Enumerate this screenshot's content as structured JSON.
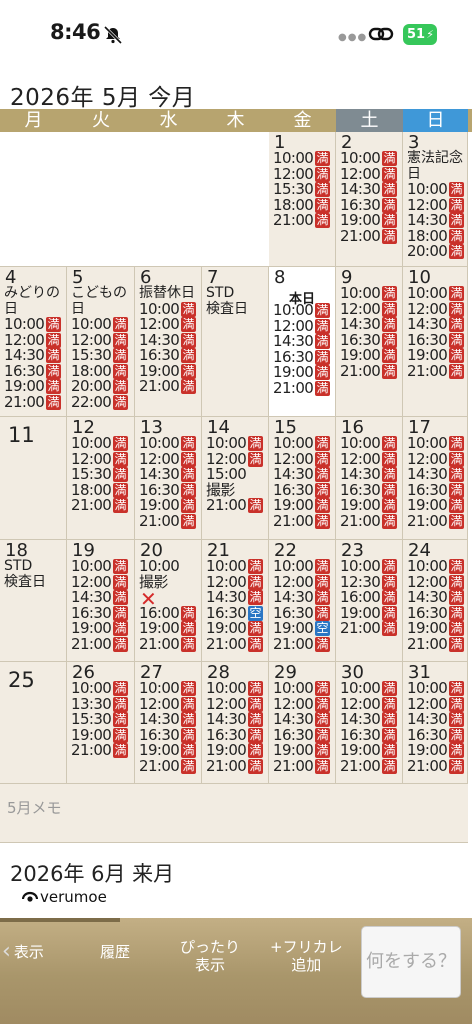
{
  "status_bar": {
    "time": "8:46",
    "battery": "51"
  },
  "current_month": {
    "title": "2026年 5月 今月"
  },
  "weekdays": [
    "月",
    "火",
    "水",
    "木",
    "金",
    "土",
    "日"
  ],
  "days": [
    {
      "n": "1",
      "slots": [
        [
          "10:00",
          "満"
        ],
        [
          "12:00",
          "満"
        ],
        [
          "15:30",
          "満"
        ],
        [
          "18:00",
          "満"
        ],
        [
          "21:00",
          "満"
        ]
      ]
    },
    {
      "n": "2",
      "slots": [
        [
          "10:00",
          "満"
        ],
        [
          "12:00",
          "満"
        ],
        [
          "14:30",
          "満"
        ],
        [
          "16:30",
          "満"
        ],
        [
          "19:00",
          "満"
        ],
        [
          "21:00",
          "満"
        ]
      ]
    },
    {
      "n": "3",
      "note": "憲法記念\n日",
      "slots": [
        [
          "10:00",
          "満"
        ],
        [
          "12:00",
          "満"
        ],
        [
          "14:30",
          "満"
        ],
        [
          "18:00",
          "満"
        ],
        [
          "20:00",
          "満"
        ]
      ]
    },
    {
      "n": "4",
      "note": "みどりの\n日",
      "slots": [
        [
          "10:00",
          "満"
        ],
        [
          "12:00",
          "満"
        ],
        [
          "14:30",
          "満"
        ],
        [
          "16:30",
          "満"
        ],
        [
          "19:00",
          "満"
        ],
        [
          "21:00",
          "満"
        ]
      ]
    },
    {
      "n": "5",
      "note": "こどもの\n日",
      "slots": [
        [
          "10:00",
          "満"
        ],
        [
          "12:00",
          "満"
        ],
        [
          "15:30",
          "満"
        ],
        [
          "18:00",
          "満"
        ],
        [
          "20:00",
          "満"
        ],
        [
          "22:00",
          "満"
        ]
      ]
    },
    {
      "n": "6",
      "note": "振替休日",
      "slots": [
        [
          "10:00",
          "満"
        ],
        [
          "12:00",
          "満"
        ],
        [
          "14:30",
          "満"
        ],
        [
          "16:30",
          "満"
        ],
        [
          "19:00",
          "満"
        ],
        [
          "21:00",
          "満"
        ]
      ]
    },
    {
      "n": "7",
      "note": "STD\n検査日",
      "slots": []
    },
    {
      "n": "8",
      "today": "本日",
      "slots": [
        [
          "10:00",
          "満"
        ],
        [
          "12:00",
          "満"
        ],
        [
          "14:30",
          "満"
        ],
        [
          "16:30",
          "満"
        ],
        [
          "19:00",
          "満"
        ],
        [
          "21:00",
          "満"
        ]
      ]
    },
    {
      "n": "9",
      "slots": [
        [
          "10:00",
          "満"
        ],
        [
          "12:00",
          "満"
        ],
        [
          "14:30",
          "満"
        ],
        [
          "16:30",
          "満"
        ],
        [
          "19:00",
          "満"
        ],
        [
          "21:00",
          "満"
        ]
      ]
    },
    {
      "n": "10",
      "slots": [
        [
          "10:00",
          "満"
        ],
        [
          "12:00",
          "満"
        ],
        [
          "14:30",
          "満"
        ],
        [
          "16:30",
          "満"
        ],
        [
          "19:00",
          "満"
        ],
        [
          "21:00",
          "満"
        ]
      ]
    },
    {
      "n": "11",
      "slots": []
    },
    {
      "n": "12",
      "slots": [
        [
          "10:00",
          "満"
        ],
        [
          "12:00",
          "満"
        ],
        [
          "15:30",
          "満"
        ],
        [
          "18:00",
          "満"
        ],
        [
          "21:00",
          "満"
        ]
      ]
    },
    {
      "n": "13",
      "slots": [
        [
          "10:00",
          "満"
        ],
        [
          "12:00",
          "満"
        ],
        [
          "14:30",
          "満"
        ],
        [
          "16:30",
          "満"
        ],
        [
          "19:00",
          "満"
        ],
        [
          "21:00",
          "満"
        ]
      ]
    },
    {
      "n": "14",
      "slots": [
        [
          "10:00",
          "満"
        ],
        [
          "12:00",
          "満"
        ],
        [
          "15:00",
          ""
        ],
        [
          "撮影",
          ""
        ],
        [
          "21:00",
          "満"
        ]
      ]
    },
    {
      "n": "15",
      "slots": [
        [
          "10:00",
          "満"
        ],
        [
          "12:00",
          "満"
        ],
        [
          "14:30",
          "満"
        ],
        [
          "16:30",
          "満"
        ],
        [
          "19:00",
          "満"
        ],
        [
          "21:00",
          "満"
        ]
      ]
    },
    {
      "n": "16",
      "slots": [
        [
          "10:00",
          "満"
        ],
        [
          "12:00",
          "満"
        ],
        [
          "14:30",
          "満"
        ],
        [
          "16:30",
          "満"
        ],
        [
          "19:00",
          "満"
        ],
        [
          "21:00",
          "満"
        ]
      ]
    },
    {
      "n": "17",
      "slots": [
        [
          "10:00",
          "満"
        ],
        [
          "12:00",
          "満"
        ],
        [
          "14:30",
          "満"
        ],
        [
          "16:30",
          "満"
        ],
        [
          "19:00",
          "満"
        ],
        [
          "21:00",
          "満"
        ]
      ]
    },
    {
      "n": "18",
      "note": "STD\n検査日",
      "slots": []
    },
    {
      "n": "19",
      "slots": [
        [
          "10:00",
          "満"
        ],
        [
          "12:00",
          "満"
        ],
        [
          "14:30",
          "満"
        ],
        [
          "16:30",
          "満"
        ],
        [
          "19:00",
          "満"
        ],
        [
          "21:00",
          "満"
        ]
      ]
    },
    {
      "n": "20",
      "slots": [
        [
          "10:00",
          ""
        ],
        [
          "撮影",
          ""
        ],
        [
          "",
          ""
        ],
        [
          "16:00",
          "満"
        ],
        [
          "19:00",
          "満"
        ],
        [
          "21:00",
          "満"
        ]
      ],
      "x_mark": "✕"
    },
    {
      "n": "21",
      "slots": [
        [
          "10:00",
          "満"
        ],
        [
          "12:00",
          "満"
        ],
        [
          "14:30",
          "満"
        ],
        [
          "16:30",
          "空"
        ],
        [
          "19:00",
          "満"
        ],
        [
          "21:00",
          "満"
        ]
      ]
    },
    {
      "n": "22",
      "slots": [
        [
          "10:00",
          "満"
        ],
        [
          "12:00",
          "満"
        ],
        [
          "14:30",
          "満"
        ],
        [
          "16:30",
          "満"
        ],
        [
          "19:00",
          "空"
        ],
        [
          "21:00",
          "満"
        ]
      ]
    },
    {
      "n": "23",
      "slots": [
        [
          "10:00",
          "満"
        ],
        [
          "12:30",
          "満"
        ],
        [
          "16:00",
          "満"
        ],
        [
          "19:00",
          "満"
        ],
        [
          "21:00",
          "満"
        ]
      ]
    },
    {
      "n": "24",
      "slots": [
        [
          "10:00",
          "満"
        ],
        [
          "12:00",
          "満"
        ],
        [
          "14:30",
          "満"
        ],
        [
          "16:30",
          "満"
        ],
        [
          "19:00",
          "満"
        ],
        [
          "21:00",
          "満"
        ]
      ]
    },
    {
      "n": "25",
      "slots": []
    },
    {
      "n": "26",
      "slots": [
        [
          "10:00",
          "満"
        ],
        [
          "13:30",
          "満"
        ],
        [
          "15:30",
          "満"
        ],
        [
          "19:00",
          "満"
        ],
        [
          "21:00",
          "満"
        ]
      ]
    },
    {
      "n": "27",
      "slots": [
        [
          "10:00",
          "満"
        ],
        [
          "12:00",
          "満"
        ],
        [
          "14:30",
          "満"
        ],
        [
          "16:30",
          "満"
        ],
        [
          "19:00",
          "満"
        ],
        [
          "21:00",
          "満"
        ]
      ]
    },
    {
      "n": "28",
      "slots": [
        [
          "10:00",
          "満"
        ],
        [
          "12:00",
          "満"
        ],
        [
          "14:30",
          "満"
        ],
        [
          "16:30",
          "満"
        ],
        [
          "19:00",
          "満"
        ],
        [
          "21:00",
          "満"
        ]
      ]
    },
    {
      "n": "29",
      "slots": [
        [
          "10:00",
          "満"
        ],
        [
          "12:00",
          "満"
        ],
        [
          "14:30",
          "満"
        ],
        [
          "16:30",
          "満"
        ],
        [
          "19:00",
          "満"
        ],
        [
          "21:00",
          "満"
        ]
      ]
    },
    {
      "n": "30",
      "slots": [
        [
          "10:00",
          "満"
        ],
        [
          "12:00",
          "満"
        ],
        [
          "14:30",
          "満"
        ],
        [
          "16:30",
          "満"
        ],
        [
          "19:00",
          "満"
        ],
        [
          "21:00",
          "満"
        ]
      ]
    },
    {
      "n": "31",
      "slots": [
        [
          "10:00",
          "満"
        ],
        [
          "12:00",
          "満"
        ],
        [
          "14:30",
          "満"
        ],
        [
          "16:30",
          "満"
        ],
        [
          "19:00",
          "満"
        ],
        [
          "21:00",
          "満"
        ]
      ]
    }
  ],
  "memo": {
    "placeholder": "5月メモ"
  },
  "next_month": {
    "title": "2026年 6月 来月"
  },
  "brand": {
    "name": "verumoe"
  },
  "toolbar": {
    "back": "表示",
    "history": "履歴",
    "fit_line1": "ぴったり",
    "fit_line2": "表示",
    "add_line1": "+フリカレ",
    "add_line2": "追加",
    "action": "何をする？"
  },
  "colors": {
    "header_gold": "#b7a46f",
    "saturday": "#7f8b92",
    "sunday": "#3f98d8",
    "full_badge": "#c9312a",
    "open_badge": "#2a76c4"
  }
}
